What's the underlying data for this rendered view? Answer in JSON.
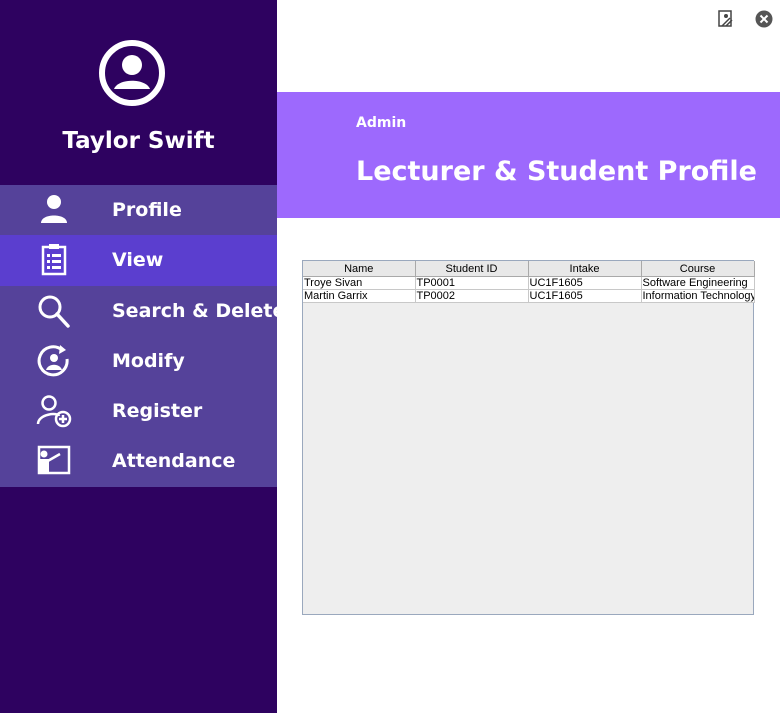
{
  "sidebar": {
    "user_name": "Taylor Swift",
    "avatar_icon": "user-circle-icon",
    "background": "#2e0260",
    "items": [
      {
        "label": "Profile",
        "icon": "person-icon",
        "active": false
      },
      {
        "label": "View",
        "icon": "clipboard-list-icon",
        "active": true
      },
      {
        "label": "Search & Delete",
        "icon": "search-icon",
        "active": false
      },
      {
        "label": "Modify",
        "icon": "refresh-user-icon",
        "active": false
      },
      {
        "label": "Register",
        "icon": "add-user-icon",
        "active": false
      },
      {
        "label": "Attendance",
        "icon": "presentation-board-icon",
        "active": false
      }
    ]
  },
  "window_controls": {
    "minimize_icon": "minimize-window-icon",
    "close_icon": "close-circle-icon"
  },
  "header": {
    "role": "Admin",
    "title": "Lecturer & Student Profile",
    "background": "#9d69fd"
  },
  "table": {
    "columns": [
      "Name",
      "Student ID",
      "Intake",
      "Course"
    ],
    "rows": [
      [
        "Troye Sivan",
        "TP0001",
        "UC1F1605",
        "Software Engineering"
      ],
      [
        "Martin Garrix",
        "TP0002",
        "UC1F1605",
        "Information Technology"
      ]
    ]
  }
}
